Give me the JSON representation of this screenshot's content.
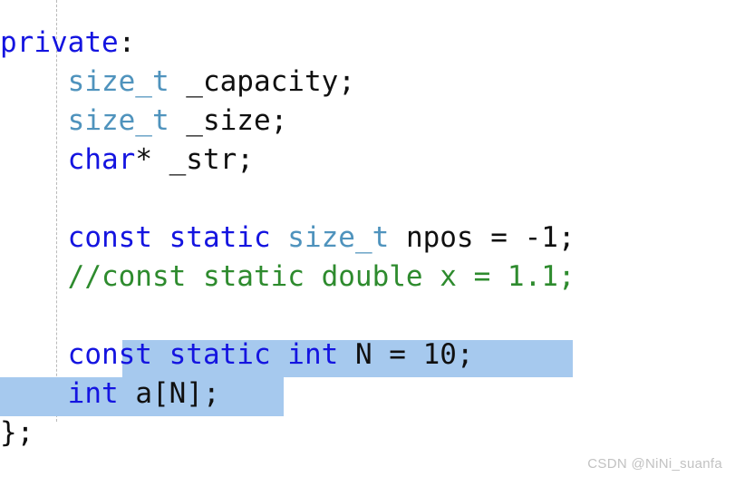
{
  "editor": {
    "language": "cpp",
    "background_color": "#ffffff",
    "selection_color": "#a6c9ee",
    "indent_guide_color": "#b9b9b9",
    "keyword_color": "#1414e0",
    "type_color": "#4f93bd",
    "comment_color": "#2e8b2e",
    "text_color": "#101010",
    "lines": [
      {
        "indent": "",
        "selected": false,
        "tokens": [
          {
            "text": "private",
            "kind": "kw"
          },
          {
            "text": ":",
            "kind": "ident"
          }
        ]
      },
      {
        "indent": "    ",
        "selected": false,
        "tokens": [
          {
            "text": "size_t",
            "kind": "type"
          },
          {
            "text": " _capacity;",
            "kind": "ident"
          }
        ]
      },
      {
        "indent": "    ",
        "selected": false,
        "tokens": [
          {
            "text": "size_t",
            "kind": "type"
          },
          {
            "text": " _size;",
            "kind": "ident"
          }
        ]
      },
      {
        "indent": "    ",
        "selected": false,
        "tokens": [
          {
            "text": "char",
            "kind": "kw"
          },
          {
            "text": "* _str;",
            "kind": "ident"
          }
        ]
      },
      {
        "indent": "",
        "selected": false,
        "tokens": []
      },
      {
        "indent": "    ",
        "selected": false,
        "tokens": [
          {
            "text": "const static ",
            "kind": "kw"
          },
          {
            "text": "size_t",
            "kind": "type"
          },
          {
            "text": " npos = -1;",
            "kind": "ident"
          }
        ]
      },
      {
        "indent": "    ",
        "selected": false,
        "tokens": [
          {
            "text": "//const static double x = 1.1;",
            "kind": "comment"
          }
        ]
      },
      {
        "indent": "",
        "selected": false,
        "tokens": []
      },
      {
        "indent": "    ",
        "selected": true,
        "tokens": [
          {
            "text": "const static int",
            "kind": "kw"
          },
          {
            "text": " N = 10;",
            "kind": "ident"
          }
        ]
      },
      {
        "indent": "    ",
        "selected": true,
        "tokens": [
          {
            "text": "int",
            "kind": "kw"
          },
          {
            "text": " a[N];",
            "kind": "ident"
          }
        ]
      },
      {
        "indent": "",
        "selected": false,
        "tokens": [
          {
            "text": "};",
            "kind": "ident"
          }
        ]
      }
    ]
  },
  "watermark": {
    "text": "CSDN @NiNi_suanfa"
  }
}
